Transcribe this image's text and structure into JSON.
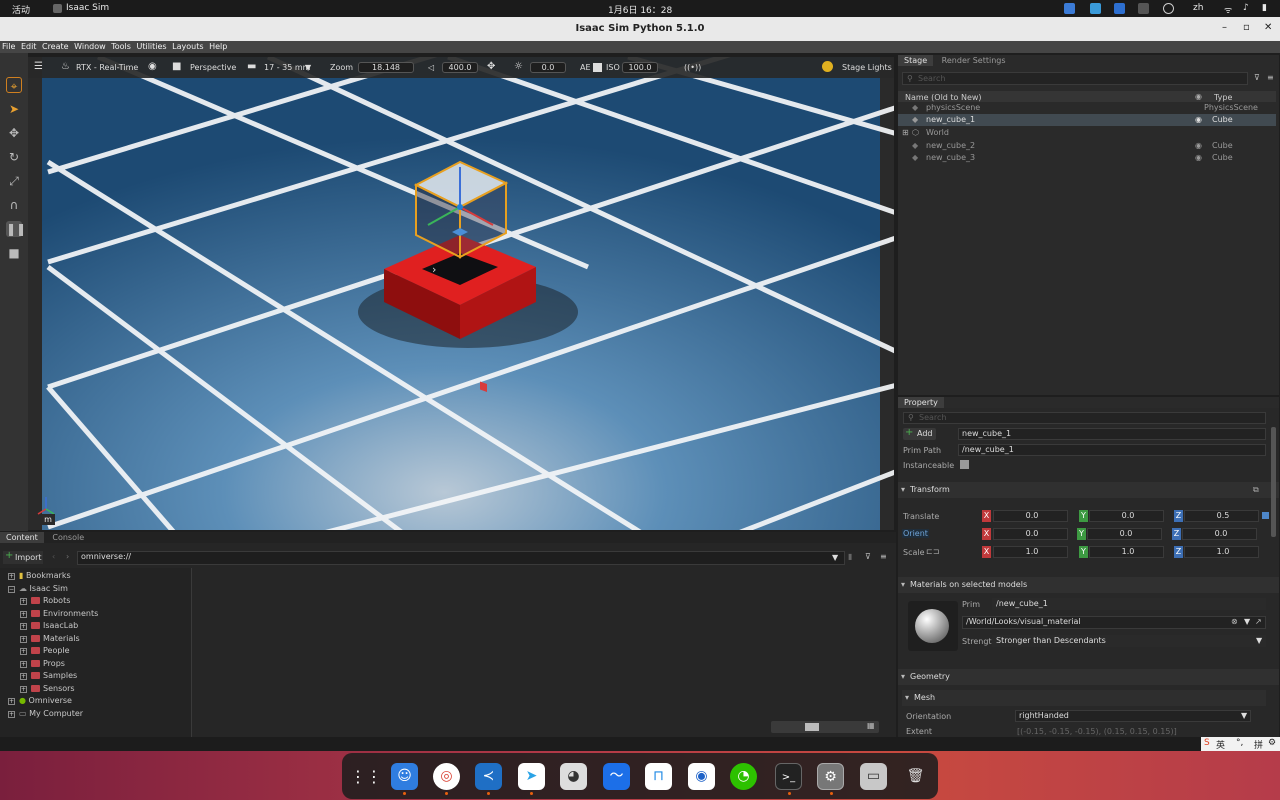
{
  "topbar": {
    "activities": "活动",
    "app_name": "Isaac Sim",
    "clock": "1月6日 16：28",
    "lang": "zh"
  },
  "window": {
    "title": "Isaac Sim Python 5.1.0",
    "min": "–",
    "max": "▫",
    "close": "✕"
  },
  "menu": [
    "File",
    "Edit",
    "Create",
    "Window",
    "Tools",
    "Utilities",
    "Layouts",
    "Help"
  ],
  "viewport_toolbar": {
    "renderer": "RTX - Real-Time",
    "camera": "Perspective",
    "lens": "17 - 35 mm",
    "zoom_label": "Zoom",
    "zoom_value": "18.148",
    "speed_value": "400.0",
    "exposure_value": "0.0",
    "ae_label": "AE",
    "iso_label": "ISO",
    "iso_value": "100.0",
    "stage_lights": "Stage Lights"
  },
  "viewport": {
    "axis_label": "m"
  },
  "stage": {
    "tabs": [
      "Stage",
      "Render Settings"
    ],
    "search_placeholder": "Search",
    "col_name": "Name (Old to New)",
    "col_type": "Type",
    "rows": [
      {
        "name": "physicsScene",
        "type": "PhysicsScene"
      },
      {
        "name": "new_cube_1",
        "type": "Cube"
      },
      {
        "name": "World",
        "type": ""
      },
      {
        "name": "new_cube_2",
        "type": "Cube"
      },
      {
        "name": "new_cube_3",
        "type": "Cube"
      }
    ]
  },
  "property": {
    "tab": "Property",
    "search_placeholder": "Search",
    "add_label": "Add",
    "name_value": "new_cube_1",
    "prim_path_label": "Prim Path",
    "prim_path_value": "/new_cube_1",
    "instanceable_label": "Instanceable",
    "transform_section": "Transform",
    "translate_label": "Translate",
    "orient_label": "Orient",
    "scale_label": "Scale",
    "translate": [
      "0.0",
      "0.0",
      "0.5"
    ],
    "orient": [
      "0.0",
      "0.0",
      "0.0"
    ],
    "scale": [
      "1.0",
      "1.0",
      "1.0"
    ],
    "axes": [
      "X",
      "Y",
      "Z"
    ],
    "materials_section": "Materials on selected models",
    "prim_label": "Prim",
    "prim_value": "/new_cube_1",
    "material_path": "/World/Looks/visual_material",
    "strength_label": "Strength",
    "strength_value": "Stronger than Descendants",
    "geometry_section": "Geometry",
    "mesh_section": "Mesh",
    "orientation_label": "Orientation",
    "orientation_value": "rightHanded",
    "extent_label": "Extent",
    "extent_value": "[(-0.15, -0.15, -0.15), (0.15, 0.15, 0.15)]"
  },
  "content": {
    "tabs": [
      "Content",
      "Console"
    ],
    "import_label": "Import",
    "path": "omniverse://",
    "tree": [
      {
        "label": "Bookmarks",
        "level": 0
      },
      {
        "label": "Isaac Sim",
        "level": 0
      },
      {
        "label": "Robots",
        "level": 1
      },
      {
        "label": "Environments",
        "level": 1
      },
      {
        "label": "IsaacLab",
        "level": 1
      },
      {
        "label": "Materials",
        "level": 1
      },
      {
        "label": "People",
        "level": 1
      },
      {
        "label": "Props",
        "level": 1
      },
      {
        "label": "Samples",
        "level": 1
      },
      {
        "label": "Sensors",
        "level": 1
      },
      {
        "label": "Omniverse",
        "level": 0
      },
      {
        "label": "My Computer",
        "level": 0
      }
    ]
  },
  "ime": {
    "label": "英"
  },
  "dock": [
    "app-grid",
    "finder",
    "chrome",
    "vscode",
    "telegram",
    "cat-app",
    "lark",
    "todesk",
    "screenshot",
    "wechat",
    "terminal",
    "isaac-sim",
    "disk",
    "trash"
  ]
}
